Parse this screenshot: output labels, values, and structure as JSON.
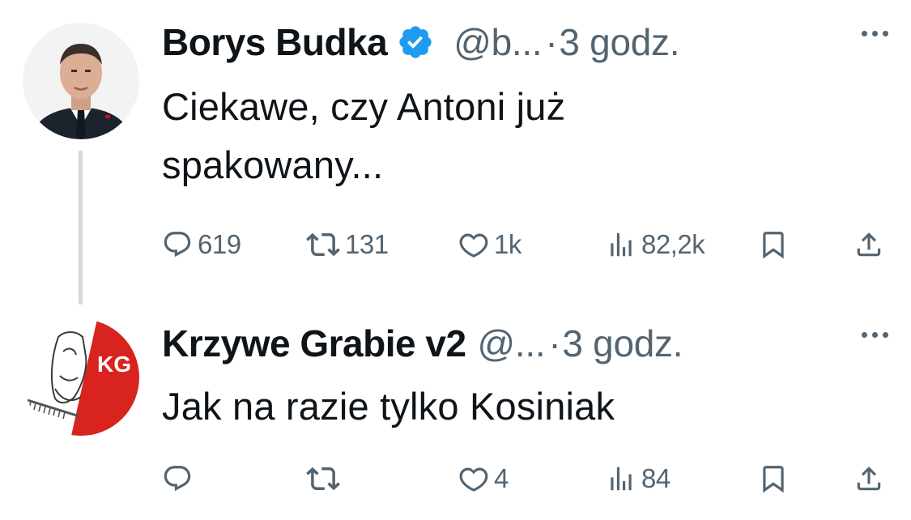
{
  "tweets": [
    {
      "author": "Borys Budka",
      "verified": true,
      "handle": "@b...",
      "separator": "·",
      "time": "3 godz.",
      "text": "Ciekawe, czy Antoni już spakowany...",
      "replies": "619",
      "retweets": "131",
      "likes": "1k",
      "views": "82,2k"
    },
    {
      "author": "Krzywe Grabie v2",
      "verified": false,
      "handle": "@...",
      "separator": "·",
      "time": "3 godz.",
      "text": "Jak na razie tylko Kosiniak",
      "replies": "",
      "retweets": "",
      "likes": "4",
      "views": "84",
      "avatar_badge": "KG"
    }
  ],
  "icons": {
    "verified": "verified-badge-icon",
    "more": "more-icon",
    "reply": "reply-icon",
    "retweet": "retweet-icon",
    "like": "heart-icon",
    "views": "views-icon",
    "bookmark": "bookmark-icon",
    "share": "share-icon"
  },
  "colors": {
    "text": "#0f1419",
    "secondary": "#536471",
    "verified": "#1d9bf0",
    "thread_line": "#cfd9de",
    "avatar_red": "#d9231f"
  }
}
